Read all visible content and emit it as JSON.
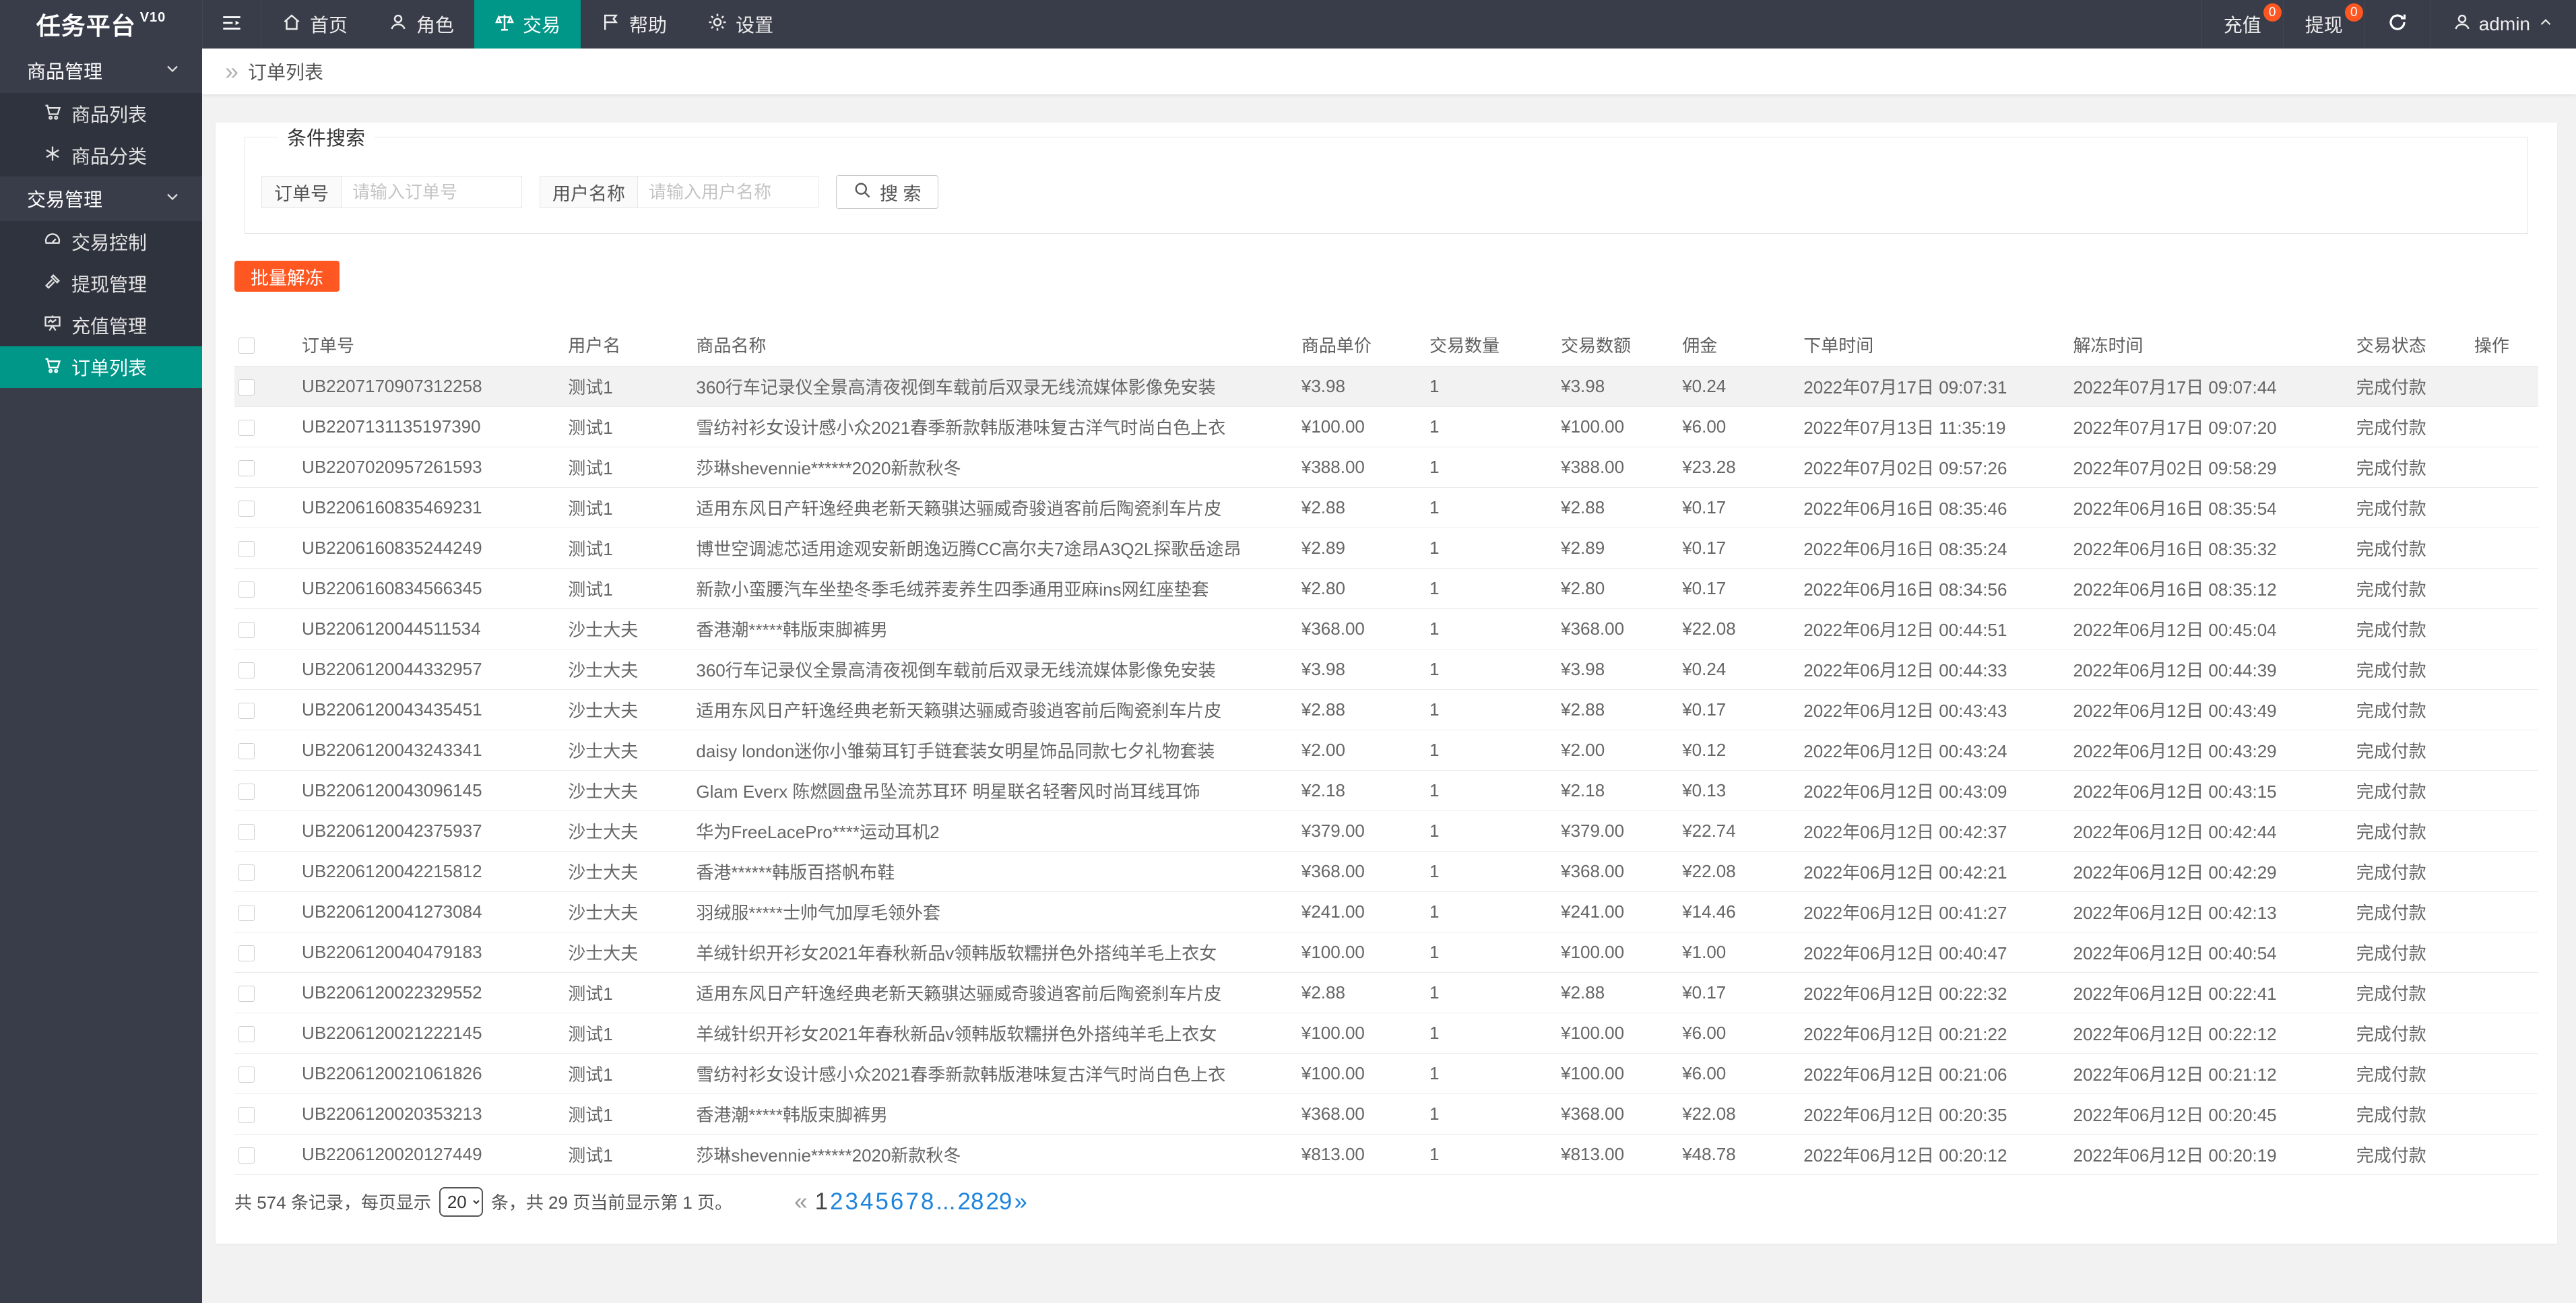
{
  "app": {
    "title": "任务平台",
    "version": "V10"
  },
  "topnav": {
    "items": [
      {
        "label": "首页",
        "icon": "home-icon",
        "active": false
      },
      {
        "label": "角色",
        "icon": "person-icon",
        "active": false
      },
      {
        "label": "交易",
        "icon": "scales-icon",
        "active": true
      },
      {
        "label": "帮助",
        "icon": "flag-icon",
        "active": false
      },
      {
        "label": "设置",
        "icon": "gear-icon",
        "active": false
      }
    ],
    "recharge": {
      "label": "充值",
      "badge": "0"
    },
    "withdraw": {
      "label": "提现",
      "badge": "0"
    },
    "user": {
      "name": "admin"
    }
  },
  "sidebar": {
    "groups": [
      {
        "label": "商品管理",
        "items": [
          {
            "label": "商品列表",
            "icon": "cart-icon"
          },
          {
            "label": "商品分类",
            "icon": "snowflake-icon"
          }
        ]
      },
      {
        "label": "交易管理",
        "items": [
          {
            "label": "交易控制",
            "icon": "gauge-icon"
          },
          {
            "label": "提现管理",
            "icon": "gavel-icon"
          },
          {
            "label": "充值管理",
            "icon": "board-icon"
          },
          {
            "label": "订单列表",
            "icon": "cart-icon",
            "active": true
          }
        ]
      }
    ]
  },
  "breadcrumb": {
    "separator": "»",
    "label": "订单列表"
  },
  "search": {
    "legend": "条件搜索",
    "order_no_label": "订单号",
    "order_no_placeholder": "请输入订单号",
    "order_no_value": "",
    "username_label": "用户名称",
    "username_placeholder": "请输入用户名称",
    "username_value": "",
    "search_label": "搜 索"
  },
  "actions": {
    "batch_unfreeze": "批量解冻"
  },
  "table": {
    "headers": [
      "订单号",
      "用户名",
      "商品名称",
      "商品单价",
      "交易数量",
      "交易数额",
      "佣金",
      "下单时间",
      "解冻时间",
      "交易状态",
      "操作"
    ],
    "rows": [
      {
        "kind": "hover",
        "no": "UB2207170907312258",
        "user": "测试1",
        "product": "360行车记录仪全景高清夜视倒车载前后双录无线流媒体影像免安装",
        "price": "¥3.98",
        "qty": "1",
        "amount": "¥3.98",
        "commission": "¥0.24",
        "created_at": "2022年07月17日 09:07:31",
        "unfrozen_at": "2022年07月17日 09:07:44",
        "status": "完成付款"
      },
      {
        "no": "UB2207131135197390",
        "user": "测试1",
        "product": "雪纺衬衫女设计感小众2021春季新款韩版港味复古洋气时尚白色上衣",
        "price": "¥100.00",
        "qty": "1",
        "amount": "¥100.00",
        "commission": "¥6.00",
        "created_at": "2022年07月13日 11:35:19",
        "unfrozen_at": "2022年07月17日 09:07:20",
        "status": "完成付款"
      },
      {
        "no": "UB2207020957261593",
        "user": "测试1",
        "product": "莎琳shevennie******2020新款秋冬",
        "price": "¥388.00",
        "qty": "1",
        "amount": "¥388.00",
        "commission": "¥23.28",
        "created_at": "2022年07月02日 09:57:26",
        "unfrozen_at": "2022年07月02日 09:58:29",
        "status": "完成付款"
      },
      {
        "no": "UB2206160835469231",
        "user": "测试1",
        "product": "适用东风日产轩逸经典老新天籁骐达骊威奇骏逍客前后陶瓷刹车片皮",
        "price": "¥2.88",
        "qty": "1",
        "amount": "¥2.88",
        "commission": "¥0.17",
        "created_at": "2022年06月16日 08:35:46",
        "unfrozen_at": "2022年06月16日 08:35:54",
        "status": "完成付款"
      },
      {
        "no": "UB2206160835244249",
        "user": "测试1",
        "product": "博世空调滤芯适用途观安新朗逸迈腾CC高尔夫7途昂A3Q2L探歌岳途昂",
        "price": "¥2.89",
        "qty": "1",
        "amount": "¥2.89",
        "commission": "¥0.17",
        "created_at": "2022年06月16日 08:35:24",
        "unfrozen_at": "2022年06月16日 08:35:32",
        "status": "完成付款"
      },
      {
        "no": "UB2206160834566345",
        "user": "测试1",
        "product": "新款小蛮腰汽车坐垫冬季毛绒荞麦养生四季通用亚麻ins网红座垫套",
        "price": "¥2.80",
        "qty": "1",
        "amount": "¥2.80",
        "commission": "¥0.17",
        "created_at": "2022年06月16日 08:34:56",
        "unfrozen_at": "2022年06月16日 08:35:12",
        "status": "完成付款"
      },
      {
        "no": "UB2206120044511534",
        "user": "沙士大夫",
        "product": "香港潮*****韩版束脚裤男",
        "price": "¥368.00",
        "qty": "1",
        "amount": "¥368.00",
        "commission": "¥22.08",
        "created_at": "2022年06月12日 00:44:51",
        "unfrozen_at": "2022年06月12日 00:45:04",
        "status": "完成付款"
      },
      {
        "no": "UB2206120044332957",
        "user": "沙士大夫",
        "product": "360行车记录仪全景高清夜视倒车载前后双录无线流媒体影像免安装",
        "price": "¥3.98",
        "qty": "1",
        "amount": "¥3.98",
        "commission": "¥0.24",
        "created_at": "2022年06月12日 00:44:33",
        "unfrozen_at": "2022年06月12日 00:44:39",
        "status": "完成付款"
      },
      {
        "no": "UB2206120043435451",
        "user": "沙士大夫",
        "product": "适用东风日产轩逸经典老新天籁骐达骊威奇骏逍客前后陶瓷刹车片皮",
        "price": "¥2.88",
        "qty": "1",
        "amount": "¥2.88",
        "commission": "¥0.17",
        "created_at": "2022年06月12日 00:43:43",
        "unfrozen_at": "2022年06月12日 00:43:49",
        "status": "完成付款"
      },
      {
        "no": "UB2206120043243341",
        "user": "沙士大夫",
        "product": "daisy london迷你小雏菊耳钉手链套装女明星饰品同款七夕礼物套装",
        "price": "¥2.00",
        "qty": "1",
        "amount": "¥2.00",
        "commission": "¥0.12",
        "created_at": "2022年06月12日 00:43:24",
        "unfrozen_at": "2022年06月12日 00:43:29",
        "status": "完成付款"
      },
      {
        "no": "UB2206120043096145",
        "user": "沙士大夫",
        "product": "Glam Everx 陈燃圆盘吊坠流苏耳环 明星联名轻奢风时尚耳线耳饰",
        "price": "¥2.18",
        "qty": "1",
        "amount": "¥2.18",
        "commission": "¥0.13",
        "created_at": "2022年06月12日 00:43:09",
        "unfrozen_at": "2022年06月12日 00:43:15",
        "status": "完成付款"
      },
      {
        "no": "UB2206120042375937",
        "user": "沙士大夫",
        "product": "华为FreeLacePro****运动耳机2",
        "price": "¥379.00",
        "qty": "1",
        "amount": "¥379.00",
        "commission": "¥22.74",
        "created_at": "2022年06月12日 00:42:37",
        "unfrozen_at": "2022年06月12日 00:42:44",
        "status": "完成付款"
      },
      {
        "no": "UB2206120042215812",
        "user": "沙士大夫",
        "product": "香港******韩版百搭帆布鞋",
        "price": "¥368.00",
        "qty": "1",
        "amount": "¥368.00",
        "commission": "¥22.08",
        "created_at": "2022年06月12日 00:42:21",
        "unfrozen_at": "2022年06月12日 00:42:29",
        "status": "完成付款"
      },
      {
        "no": "UB2206120041273084",
        "user": "沙士大夫",
        "product": "羽绒服*****士帅气加厚毛领外套",
        "price": "¥241.00",
        "qty": "1",
        "amount": "¥241.00",
        "commission": "¥14.46",
        "created_at": "2022年06月12日 00:41:27",
        "unfrozen_at": "2022年06月12日 00:42:13",
        "status": "完成付款"
      },
      {
        "no": "UB2206120040479183",
        "user": "沙士大夫",
        "product": "羊绒针织开衫女2021年春秋新品v领韩版软糯拼色外搭纯羊毛上衣女",
        "price": "¥100.00",
        "qty": "1",
        "amount": "¥100.00",
        "commission": "¥1.00",
        "created_at": "2022年06月12日 00:40:47",
        "unfrozen_at": "2022年06月12日 00:40:54",
        "status": "完成付款"
      },
      {
        "no": "UB2206120022329552",
        "user": "测试1",
        "product": "适用东风日产轩逸经典老新天籁骐达骊威奇骏逍客前后陶瓷刹车片皮",
        "price": "¥2.88",
        "qty": "1",
        "amount": "¥2.88",
        "commission": "¥0.17",
        "created_at": "2022年06月12日 00:22:32",
        "unfrozen_at": "2022年06月12日 00:22:41",
        "status": "完成付款"
      },
      {
        "no": "UB2206120021222145",
        "user": "测试1",
        "product": "羊绒针织开衫女2021年春秋新品v领韩版软糯拼色外搭纯羊毛上衣女",
        "price": "¥100.00",
        "qty": "1",
        "amount": "¥100.00",
        "commission": "¥6.00",
        "created_at": "2022年06月12日 00:21:22",
        "unfrozen_at": "2022年06月12日 00:22:12",
        "status": "完成付款"
      },
      {
        "no": "UB2206120021061826",
        "user": "测试1",
        "product": "雪纺衬衫女设计感小众2021春季新款韩版港味复古洋气时尚白色上衣",
        "price": "¥100.00",
        "qty": "1",
        "amount": "¥100.00",
        "commission": "¥6.00",
        "created_at": "2022年06月12日 00:21:06",
        "unfrozen_at": "2022年06月12日 00:21:12",
        "status": "完成付款"
      },
      {
        "no": "UB2206120020353213",
        "user": "测试1",
        "product": "香港潮*****韩版束脚裤男",
        "price": "¥368.00",
        "qty": "1",
        "amount": "¥368.00",
        "commission": "¥22.08",
        "created_at": "2022年06月12日 00:20:35",
        "unfrozen_at": "2022年06月12日 00:20:45",
        "status": "完成付款"
      },
      {
        "no": "UB2206120020127449",
        "user": "测试1",
        "product": "莎琳shevennie******2020新款秋冬",
        "price": "¥813.00",
        "qty": "1",
        "amount": "¥813.00",
        "commission": "¥48.78",
        "created_at": "2022年06月12日 00:20:12",
        "unfrozen_at": "2022年06月12日 00:20:19",
        "status": "完成付款"
      }
    ]
  },
  "footer": {
    "summary_prefix": "共 574 条记录，每页显示",
    "per_page": "20",
    "summary_suffix": "条，共 29 页当前显示第 1 页。"
  },
  "pagination": {
    "items": [
      {
        "label": "«",
        "kind": "nav"
      },
      {
        "label": "1",
        "kind": "current"
      },
      {
        "label": "2",
        "kind": "link"
      },
      {
        "label": "3",
        "kind": "link"
      },
      {
        "label": "4",
        "kind": "link"
      },
      {
        "label": "5",
        "kind": "link"
      },
      {
        "label": "6",
        "kind": "link"
      },
      {
        "label": "7",
        "kind": "link"
      },
      {
        "label": "8",
        "kind": "link"
      },
      {
        "label": "...",
        "kind": "link"
      },
      {
        "label": "28",
        "kind": "link"
      },
      {
        "label": "29",
        "kind": "link"
      },
      {
        "label": "»",
        "kind": "link"
      }
    ]
  },
  "colors": {
    "accent_teal": "#009688",
    "accent_orange": "#FF5722",
    "link_blue": "#1E84DC"
  }
}
